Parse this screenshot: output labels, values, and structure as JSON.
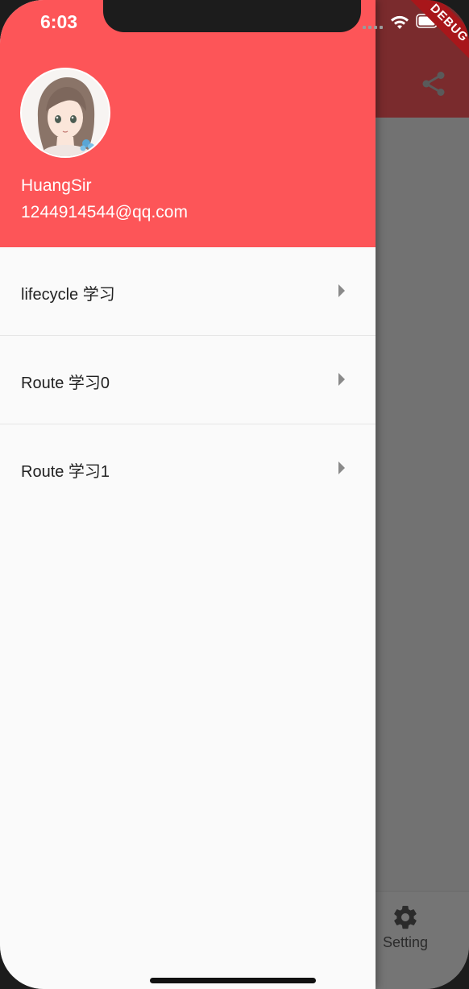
{
  "status_bar": {
    "time": "6:03"
  },
  "debug_banner": "DEBUG",
  "drawer": {
    "header": {
      "account_name": "HuangSir",
      "account_email": "1244914544@qq.com",
      "header_color": "#fd5558"
    },
    "items": [
      {
        "label": "lifecycle 学习",
        "icon": "arrow-right-icon"
      },
      {
        "label": "Route 学习0",
        "icon": "arrow-right-icon"
      },
      {
        "label": "Route 学习1",
        "icon": "arrow-right-icon"
      }
    ]
  },
  "background_app": {
    "appbar_action_icon": "share-icon",
    "bottom_tab": {
      "label": "Setting",
      "icon": "gear-icon"
    }
  }
}
